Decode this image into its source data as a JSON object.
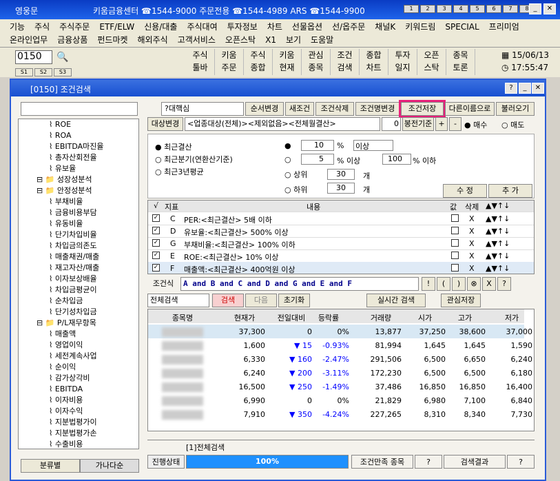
{
  "app": {
    "title": "영웅문",
    "center_text": "키움금융센터 ☎1544-9000 주문전용 ☎1544-4989 ARS ☎1544-9900",
    "num_buttons": [
      "1",
      "2",
      "3",
      "4",
      "5",
      "6",
      "7",
      "8"
    ]
  },
  "menu": {
    "row1": [
      "기능",
      "주식",
      "주식주문",
      "ETF/ELW",
      "신용/대출",
      "주식대여",
      "투자정보",
      "차트",
      "선물옵션",
      "선/옵주문",
      "채널K",
      "키워드림",
      "SPECIAL",
      "프리미엄"
    ],
    "row2": [
      "온라인업무",
      "금융상품",
      "펀드마켓",
      "해외주식",
      "고객서비스",
      "오픈스탁",
      "X1",
      "보기",
      "도움말"
    ]
  },
  "toolbar": {
    "screen_no": "0150",
    "tabs": [
      "S1",
      "S2",
      "S3"
    ],
    "buttons": [
      [
        "주식",
        "툴바"
      ],
      [
        "키움",
        "주문"
      ],
      [
        "주식",
        "종합"
      ],
      [
        "키움",
        "현재"
      ],
      [
        "관심",
        "종목"
      ],
      [
        "조건",
        "검색"
      ],
      [
        "종합",
        "차트"
      ],
      [
        "투자",
        "일지"
      ],
      [
        "오픈",
        "스탁"
      ],
      [
        "종목",
        "토론"
      ]
    ],
    "date": "15/06/13",
    "time": "17:55:47"
  },
  "window": {
    "title": "[0150] 조건검색"
  },
  "left": {
    "tree": [
      {
        "t": "ROE",
        "lv": 2
      },
      {
        "t": "ROA",
        "lv": 2
      },
      {
        "t": "EBITDA마진율",
        "lv": 2
      },
      {
        "t": "총자산회전율",
        "lv": 2
      },
      {
        "t": "유보율",
        "lv": 2
      },
      {
        "t": "성장성분석",
        "lv": 1
      },
      {
        "t": "안정성분석",
        "lv": 1
      },
      {
        "t": "부채비율",
        "lv": 2
      },
      {
        "t": "금융비용부담",
        "lv": 2
      },
      {
        "t": "유동비율",
        "lv": 2
      },
      {
        "t": "단기차입비율",
        "lv": 2
      },
      {
        "t": "차입금의존도",
        "lv": 2
      },
      {
        "t": "매출채권/매출",
        "lv": 2
      },
      {
        "t": "재고자산/매출",
        "lv": 2
      },
      {
        "t": "이자보상배율",
        "lv": 2
      },
      {
        "t": "차입금평균이",
        "lv": 2
      },
      {
        "t": "순차입금",
        "lv": 2
      },
      {
        "t": "단기성차입금",
        "lv": 2
      },
      {
        "t": "P/L재무항목",
        "lv": 1
      },
      {
        "t": "매출액",
        "lv": 2
      },
      {
        "t": "영업이익",
        "lv": 2
      },
      {
        "t": "세전계속사업",
        "lv": 2
      },
      {
        "t": "순이익",
        "lv": 2
      },
      {
        "t": "감가상각비",
        "lv": 2
      },
      {
        "t": "EBITDA",
        "lv": 2
      },
      {
        "t": "이자비용",
        "lv": 2
      },
      {
        "t": "이자수익",
        "lv": 2
      },
      {
        "t": "지분법평가이",
        "lv": 2
      },
      {
        "t": "지분법평가손",
        "lv": 2
      },
      {
        "t": "수출비용",
        "lv": 2
      }
    ],
    "tabs": [
      "분류별",
      "가나다순"
    ]
  },
  "cond": {
    "name": "?대핵심",
    "btns": [
      "순서변경",
      "새조건",
      "조건삭제",
      "조건명변경",
      "조건저장",
      "다른이름으로",
      "불러오기"
    ],
    "target_btn": "대상변경",
    "target_text": "<업종대상(전체)><제외없음><전체월결산>",
    "spin": "0",
    "basis": "봉전기준",
    "buy": "매수",
    "sell": "매도",
    "periods": [
      "최근결산",
      "최근분기(연환산기준)",
      "최근3년평균"
    ],
    "v10": "10",
    "pct": "%",
    "above": "이상",
    "v5": "5",
    "v100": "100",
    "pct_above": "% 이상",
    "pct_below": "% 이하",
    "top": "상위",
    "bottom": "하위",
    "v30a": "30",
    "v30b": "30",
    "unit": "개",
    "edit": "수 정",
    "add": "추 가"
  },
  "ctable": {
    "headers": [
      "√",
      "지표",
      "내용",
      "값",
      "삭제"
    ],
    "rows": [
      {
        "k": "C",
        "c": "PER:<최근결산> 5배 이하"
      },
      {
        "k": "D",
        "c": "유보율:<최근결산> 500% 이상"
      },
      {
        "k": "G",
        "c": "부채비율:<최근결산> 100% 이하"
      },
      {
        "k": "E",
        "c": "ROE:<최근결산> 10% 이상"
      },
      {
        "k": "F",
        "c": "매출액:<최근결산> 400억원 이상"
      }
    ]
  },
  "formula": {
    "label": "조건식",
    "text": "A and B and C and D and G and E and F",
    "btns": [
      "!",
      "(",
      ")",
      "⊗",
      "X",
      "?"
    ]
  },
  "search": {
    "mode": "전체검색",
    "search": "검색",
    "next": "다음",
    "reset": "초기화",
    "realtime": "실시간 검색",
    "save_fav": "관심저장"
  },
  "results": {
    "headers": [
      "종목명",
      "현재가",
      "전일대비",
      "등락률",
      "거래량",
      "시가",
      "고가",
      "저가"
    ],
    "rows": [
      [
        "37,300",
        "0",
        "0%",
        "13,877",
        "37,250",
        "38,600",
        "37,000"
      ],
      [
        "1,600",
        "15",
        "-0.93%",
        "81,994",
        "1,645",
        "1,645",
        "1,590"
      ],
      [
        "6,330",
        "160",
        "-2.47%",
        "291,506",
        "6,500",
        "6,650",
        "6,240"
      ],
      [
        "6,240",
        "200",
        "-3.11%",
        "172,230",
        "6,500",
        "6,500",
        "6,180"
      ],
      [
        "16,500",
        "250",
        "-1.49%",
        "37,486",
        "16,850",
        "16,850",
        "16,400"
      ],
      [
        "6,990",
        "0",
        "0%",
        "21,829",
        "6,980",
        "7,100",
        "6,840"
      ],
      [
        "7,910",
        "350",
        "-4.24%",
        "227,265",
        "8,310",
        "8,340",
        "7,730"
      ]
    ],
    "tab": "[1]전체검색"
  },
  "status": {
    "label": "진행상태",
    "progress": "100%",
    "progress_value": 1.0,
    "count_label": "조건만족 종목",
    "count": "?",
    "result_label": "검색결과",
    "result": "?"
  }
}
